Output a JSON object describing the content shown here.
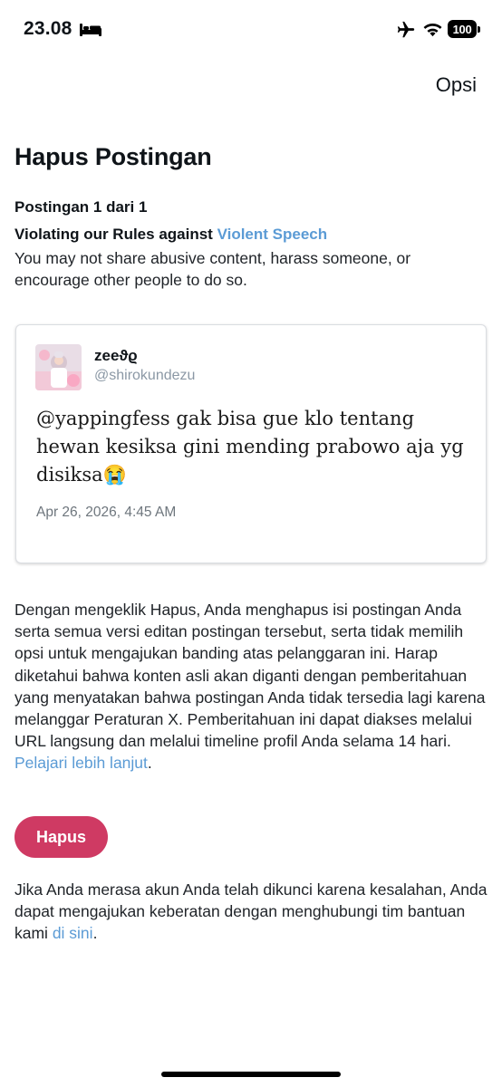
{
  "status_bar": {
    "time": "23.08",
    "battery": "100"
  },
  "header": {
    "options_label": "Opsi",
    "title": "Hapus Postingan"
  },
  "violation": {
    "counter": "Postingan 1 dari 1",
    "rule_prefix": "Violating our Rules against ",
    "rule_link": "Violent Speech",
    "description": "You may not share abusive content, harass someone, or encourage other people to do so."
  },
  "tweet": {
    "display_name": "zeeϑϱ",
    "handle": "@shirokundezu",
    "text": "@yappingfess gak bisa gue klo tentang hewan kesiksa gini mending prabowo aja yg disiksa😭",
    "date": "Apr 26, 2026, 4:45 AM"
  },
  "explanation": {
    "text": "Dengan mengeklik Hapus, Anda menghapus isi postingan Anda serta semua versi editan postingan tersebut, serta tidak memilih opsi untuk mengajukan banding atas pelanggaran ini. Harap diketahui bahwa konten asli akan diganti dengan pemberitahuan yang menyatakan bahwa postingan Anda tidak tersedia lagi karena melanggar Peraturan X. Pemberitahuan ini dapat diakses melalui URL langsung dan melalui timeline profil Anda selama 14 hari. ",
    "link": "Pelajari lebih lanjut",
    "suffix": "."
  },
  "actions": {
    "delete_label": "Hapus"
  },
  "appeal": {
    "text": "Jika Anda merasa akun Anda telah dikunci karena kesalahan, Anda dapat mengajukan keberatan dengan menghubungi tim bantuan kami ",
    "link": "di sini",
    "suffix": "."
  },
  "colors": {
    "link": "#5b9bd5",
    "delete_button": "#cf3a63"
  },
  "icons": [
    "bed-icon",
    "airplane-icon",
    "wifi-icon",
    "battery-icon"
  ]
}
